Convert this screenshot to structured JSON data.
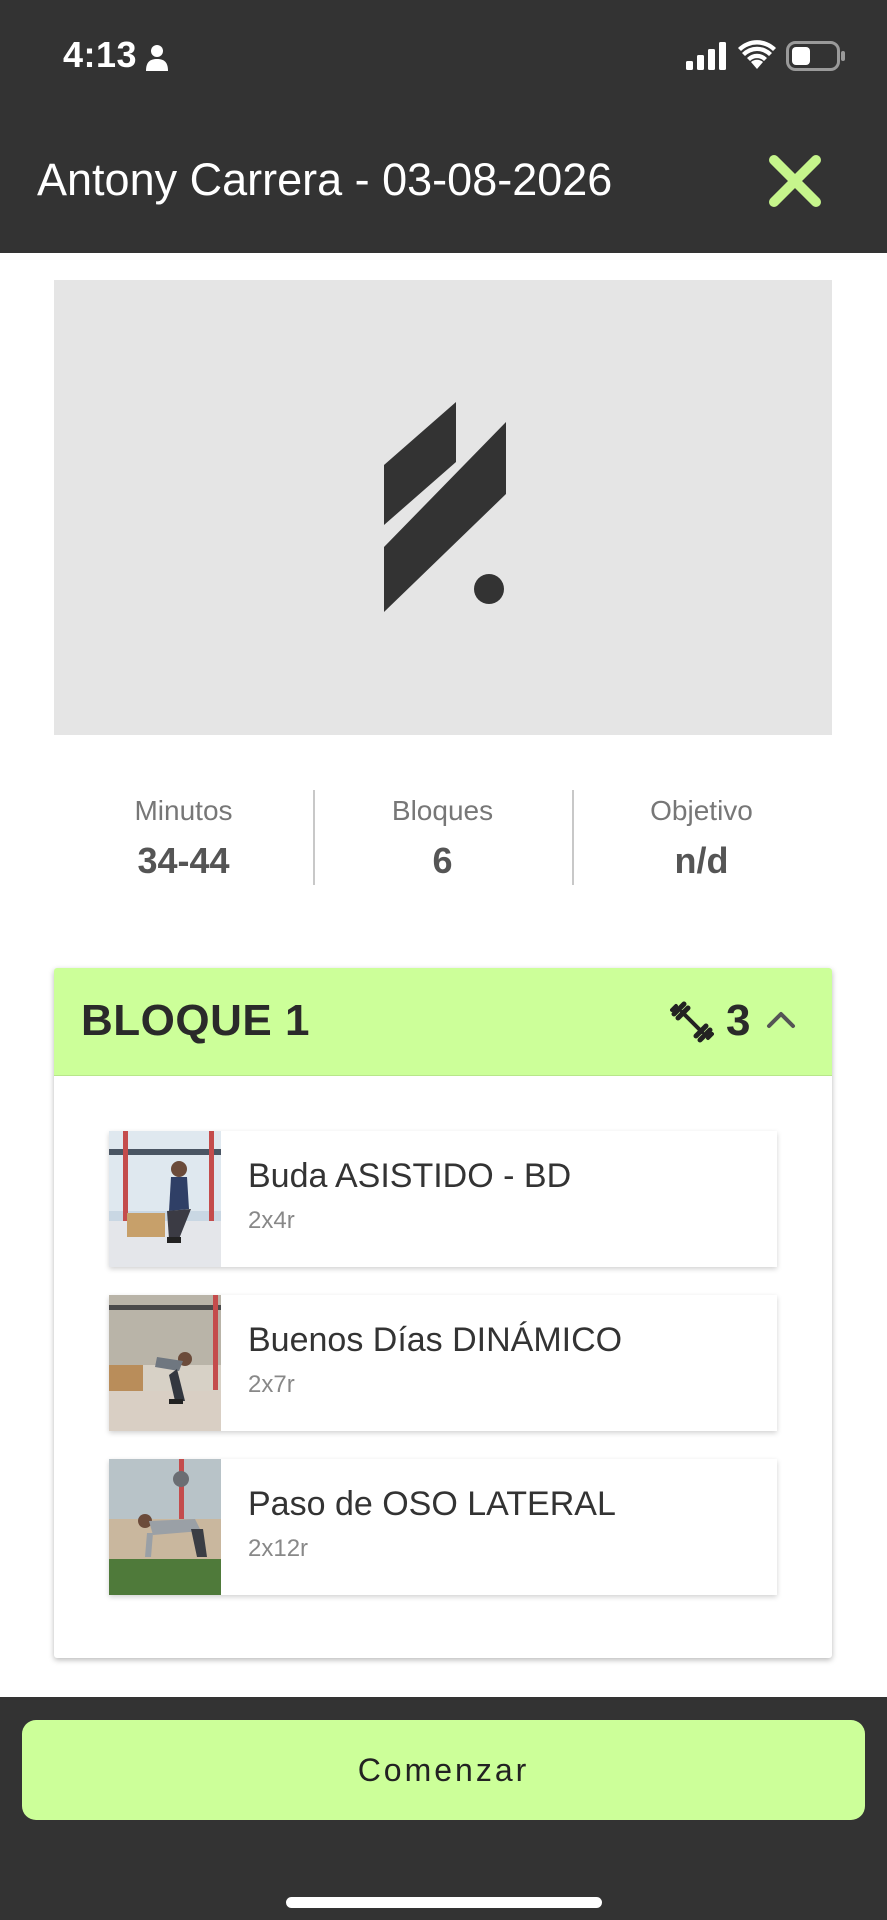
{
  "status_bar": {
    "time": "4:13"
  },
  "header": {
    "title": "Antony Carrera - 03-08-2026",
    "close_icon": "close-icon"
  },
  "stats": [
    {
      "label": "Minutos",
      "value": "34-44"
    },
    {
      "label": "Bloques",
      "value": "6"
    },
    {
      "label": "Objetivo",
      "value": "n/d"
    }
  ],
  "block": {
    "title": "BLOQUE 1",
    "count": "3",
    "icon": "dumbbell-icon",
    "expanded": true,
    "exercises": [
      {
        "name": "Buda ASISTIDO - BD",
        "detail": "2x4r"
      },
      {
        "name": "Buenos Días DINÁMICO",
        "detail": "2x7r"
      },
      {
        "name": "Paso de OSO LATERAL",
        "detail": "2x12r"
      }
    ]
  },
  "footer": {
    "start_label": "Comenzar"
  },
  "colors": {
    "accent": "#ccff99",
    "dark": "#333333",
    "close_x": "#c6f58c"
  }
}
